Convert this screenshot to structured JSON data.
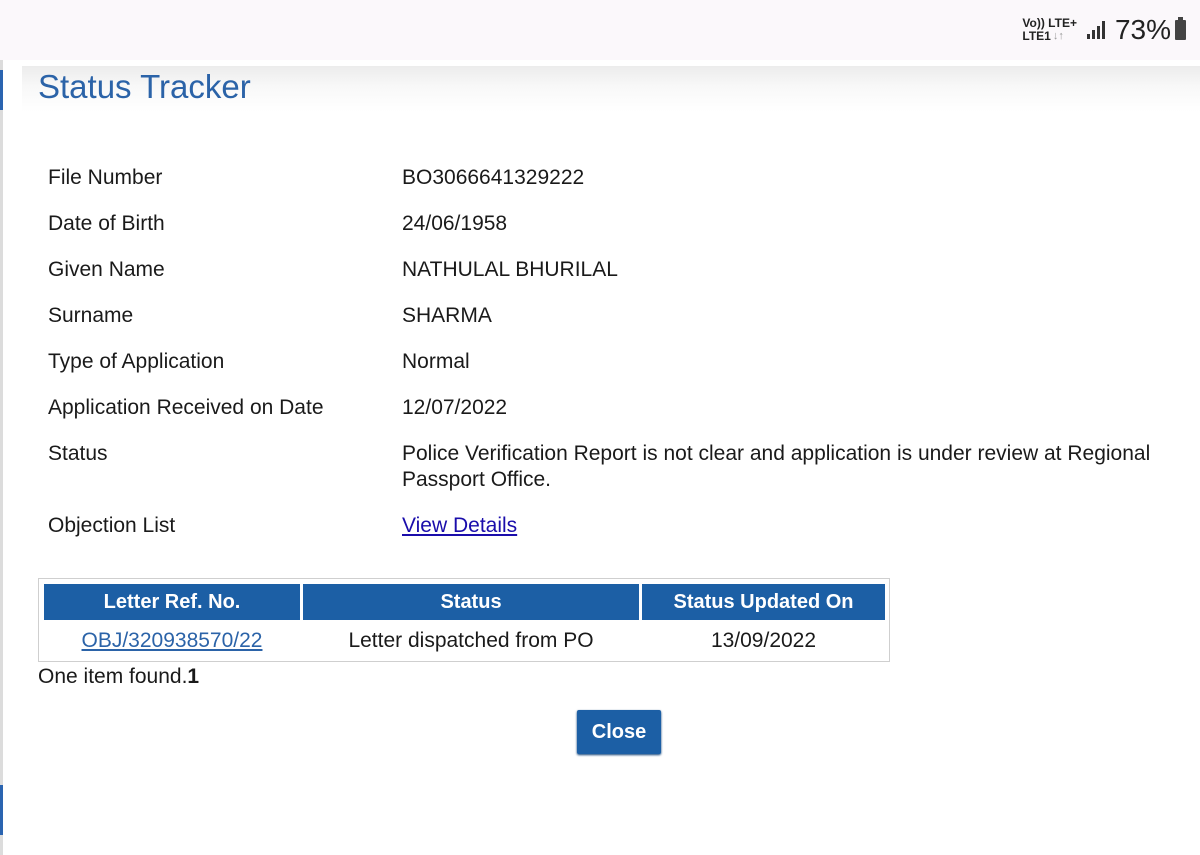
{
  "status_bar": {
    "volte_label": "Vo))",
    "lte_plus_label": "LTE+",
    "lte1_label": "LTE1",
    "battery_percent": "73%"
  },
  "page": {
    "title": "Status Tracker"
  },
  "details": [
    {
      "label": "File Number",
      "value": "BO3066641329222"
    },
    {
      "label": "Date of Birth",
      "value": "24/06/1958"
    },
    {
      "label": "Given Name",
      "value": "NATHULAL BHURILAL"
    },
    {
      "label": "Surname",
      "value": "SHARMA"
    },
    {
      "label": "Type of Application",
      "value": "Normal"
    },
    {
      "label": "Application Received on Date",
      "value": "12/07/2022"
    },
    {
      "label": "Status",
      "value": "Police Verification Report is not clear and application is under review at Regional Passport Office."
    },
    {
      "label": "Objection List",
      "value": "View Details"
    }
  ],
  "table": {
    "headers": [
      "Letter Ref. No.",
      "Status",
      "Status Updated On"
    ],
    "rows": [
      {
        "ref": "OBJ/320938570/22",
        "status": "Letter dispatched from PO",
        "updated": "13/09/2022"
      }
    ]
  },
  "footer": {
    "found_text": "One item found.",
    "found_count": "1"
  },
  "close_label": "Close",
  "colors": {
    "accent": "#1c5fa5",
    "title": "#2b63a8",
    "link": "#1a0dab"
  }
}
